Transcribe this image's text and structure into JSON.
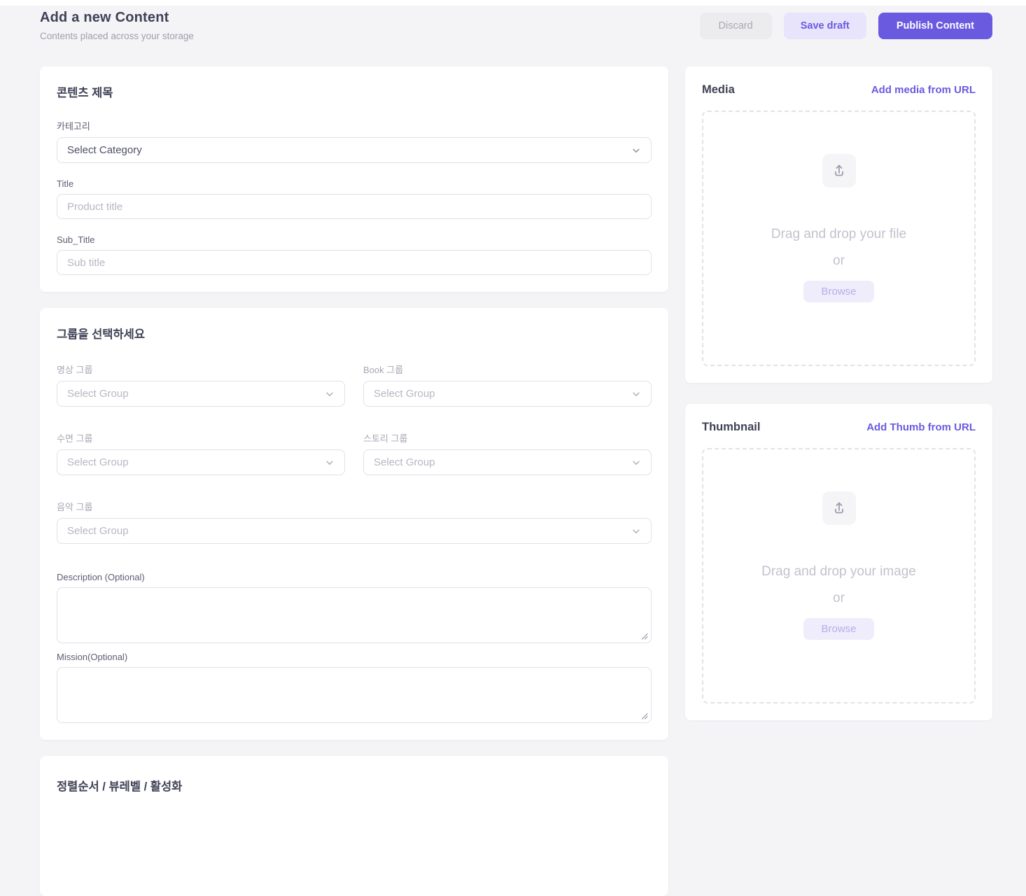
{
  "header": {
    "title": "Add a new Content",
    "subtitle": "Contents placed across your storage",
    "actions": {
      "discard": "Discard",
      "save_draft": "Save draft",
      "publish": "Publish Content"
    }
  },
  "colors": {
    "accent": "#6a5ae0",
    "accent_light": "#e7e4fb",
    "page_bg": "#f4f4f7"
  },
  "title_card": {
    "heading": "콘텐츠 제목",
    "category_label": "카테고리",
    "category_value": "Select Category",
    "title_label": "Title",
    "title_placeholder": "Product title",
    "subtitle_label": "Sub_Title",
    "subtitle_placeholder": "Sub title"
  },
  "group_card": {
    "heading": "그룹을 선택하세요",
    "select_placeholder": "Select Group",
    "groups": [
      {
        "label": "명상 그룹"
      },
      {
        "label": "Book 그룹"
      },
      {
        "label": "수면 그룹"
      },
      {
        "label": "스토리 그룹"
      },
      {
        "label": "음악 그룹"
      }
    ],
    "description_label": "Description (Optional)",
    "mission_label": "Mission(Optional)"
  },
  "sort_card": {
    "heading": "정렬순서 / 뷰레벨 / 활성화"
  },
  "media_card": {
    "heading": "Media",
    "link": "Add media from URL",
    "drop_text": "Drag and drop your file",
    "or_text": "or",
    "browse_label": "Browse"
  },
  "thumbnail_card": {
    "heading": "Thumbnail",
    "link": "Add Thumb from URL",
    "drop_text": "Drag and drop your image",
    "or_text": "or",
    "browse_label": "Browse"
  }
}
